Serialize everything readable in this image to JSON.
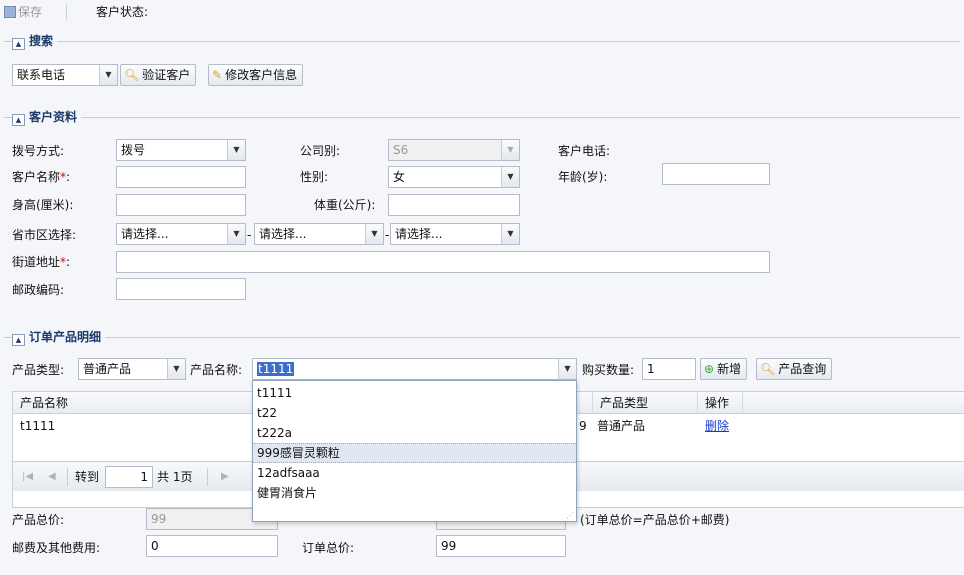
{
  "toolbar": {
    "save_label": "保存",
    "status_label": "客户状态:"
  },
  "search": {
    "legend": "搜索",
    "type_value": "联系电话",
    "verify_btn": "验证客户",
    "modify_btn": "修改客户信息"
  },
  "customer": {
    "legend": "客户资料",
    "dial_label": "拨号方式:",
    "dial_value": "拨号",
    "company_label": "公司别:",
    "company_value": "S6",
    "phone_label": "客户电话:",
    "name_label": "客户名称",
    "req": "*",
    "colon": ":",
    "gender_label": "性别:",
    "gender_value": "女",
    "age_label": "年龄(岁):",
    "height_label": "身高(厘米):",
    "weight_label": "体重(公斤):",
    "region_label": "省市区选择:",
    "province_value": "请选择...",
    "city_value": "请选择...",
    "district_value": "请选择...",
    "dash": "-",
    "street_label": "街道地址",
    "zip_label": "邮政编码:"
  },
  "order": {
    "legend": "订单产品明细",
    "ptype_label": "产品类型:",
    "ptype_value": "普通产品",
    "pname_label": "产品名称:",
    "pname_value": "t1111",
    "qty_label": "购买数量:",
    "qty_value": "1",
    "add_btn": "新增",
    "query_btn": "产品查询",
    "dropdown": [
      "t1111",
      "t22",
      "t222a",
      "999感冒灵颗粒",
      "12adfsaaa",
      "健胃消食片"
    ],
    "grid": {
      "headers": [
        "产品名称",
        "产品类型",
        "操作"
      ],
      "rows": [
        {
          "name": "t1111",
          "partial": "9",
          "type": "普通产品",
          "action": "删除"
        }
      ]
    },
    "pager": {
      "goto": "转到",
      "page": "1",
      "total": "共 1页"
    },
    "total_label": "产品总价:",
    "total_value": "99",
    "formula_note": "(订单总价=产品总价+邮费)",
    "postage_label": "邮费及其他费用:",
    "postage_value": "0",
    "order_total_label": "订单总价:",
    "order_total_value": "99"
  },
  "colors": {
    "accent": "#1b3a6b",
    "required": "#ee0000",
    "link": "#1a3cc8",
    "add_icon": "#3aa63a"
  }
}
